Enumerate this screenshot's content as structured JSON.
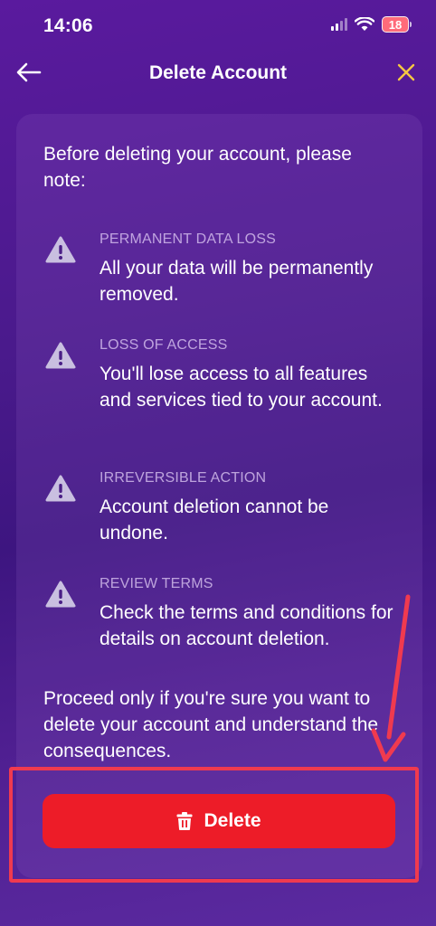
{
  "status_bar": {
    "time": "14:06",
    "battery": "18"
  },
  "header": {
    "title": "Delete Account",
    "back_icon": "arrow-left-icon",
    "close_icon": "close-icon",
    "close_color": "#f5c842"
  },
  "content": {
    "intro": "Before deleting your account, please note:",
    "notices": [
      {
        "icon": "warning-icon",
        "heading": "PERMANENT DATA LOSS",
        "body": "All your data will be permanently removed."
      },
      {
        "icon": "warning-icon",
        "heading": "LOSS OF ACCESS",
        "body": "You'll lose access to all features and services tied to your account."
      },
      {
        "icon": "warning-icon",
        "heading": "IRREVERSIBLE ACTION",
        "body": "Account deletion cannot be undone."
      },
      {
        "icon": "warning-icon",
        "heading": "REVIEW TERMS",
        "body": "Check the terms and conditions for details on account deletion."
      }
    ],
    "outro": "Proceed only if you're sure you want to delete your account and understand the consequences."
  },
  "actions": {
    "delete_label": "Delete",
    "delete_icon": "trash-icon",
    "delete_color": "#ed1c28"
  },
  "annotation": {
    "highlight_color": "#f03a4f"
  }
}
